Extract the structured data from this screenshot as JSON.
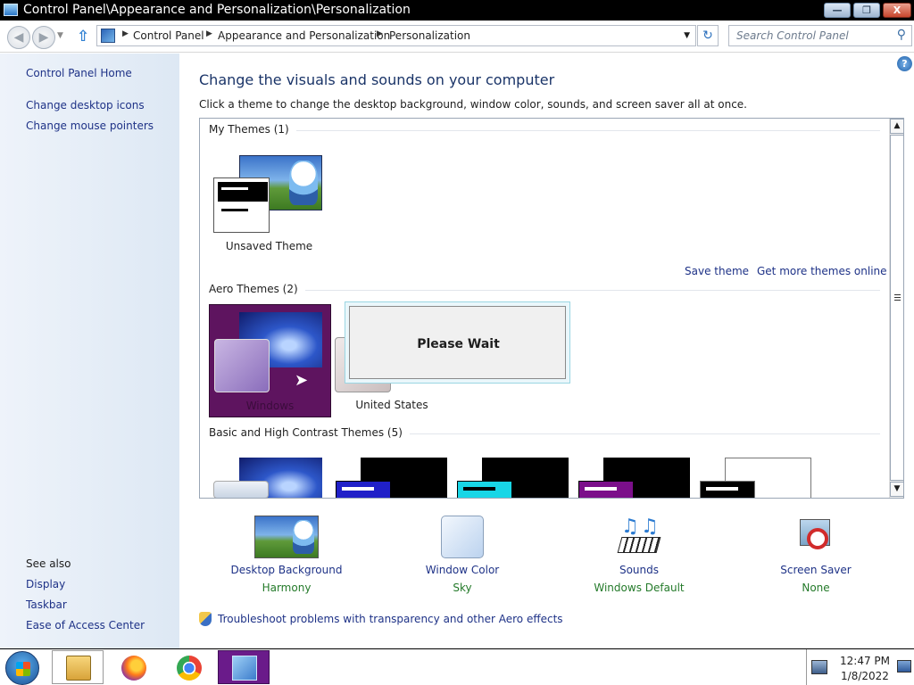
{
  "window": {
    "title": "Control Panel\\Appearance and Personalization\\Personalization",
    "minimize": "—",
    "maximize": "❐",
    "close": "X"
  },
  "address": {
    "crumbs": [
      "Control Panel",
      "Appearance and Personalization",
      "Personalization"
    ],
    "search_placeholder": "Search Control Panel"
  },
  "sidebar": {
    "home": "Control Panel Home",
    "links": [
      "Change desktop icons",
      "Change mouse pointers"
    ],
    "see_also": "See also",
    "see_also_links": [
      "Display",
      "Taskbar",
      "Ease of Access Center"
    ]
  },
  "main": {
    "heading": "Change the visuals and sounds on your computer",
    "subtitle": "Click a theme to change the desktop background, window color, sounds, and screen saver all at once.",
    "help": "?"
  },
  "themes": {
    "my_themes_title": "My Themes (1)",
    "unsaved_theme": "Unsaved Theme",
    "save_theme": "Save theme",
    "get_more": "Get more themes online",
    "aero_title": "Aero Themes (2)",
    "aero_items": [
      "Windows",
      "United States"
    ],
    "basic_title": "Basic and High Contrast Themes (5)"
  },
  "dialog": {
    "text": "Please Wait"
  },
  "settings": [
    {
      "label": "Desktop Background",
      "value": "Harmony",
      "icon": "desktop-background-icon"
    },
    {
      "label": "Window Color",
      "value": "Sky",
      "icon": "window-color-icon"
    },
    {
      "label": "Sounds",
      "value": "Windows Default",
      "icon": "sounds-icon"
    },
    {
      "label": "Screen Saver",
      "value": "None",
      "icon": "screen-saver-icon"
    }
  ],
  "troubleshoot": "Troubleshoot problems with transparency and other Aero effects",
  "taskbar": {
    "time": "12:47 PM",
    "date": "1/8/2022",
    "apps": [
      "file-explorer-icon",
      "firefox-icon",
      "chrome-icon",
      "control-panel-icon"
    ]
  },
  "colors": {
    "link": "#1e3287",
    "value_green": "#247a2a",
    "selected_theme": "#5e145f"
  }
}
